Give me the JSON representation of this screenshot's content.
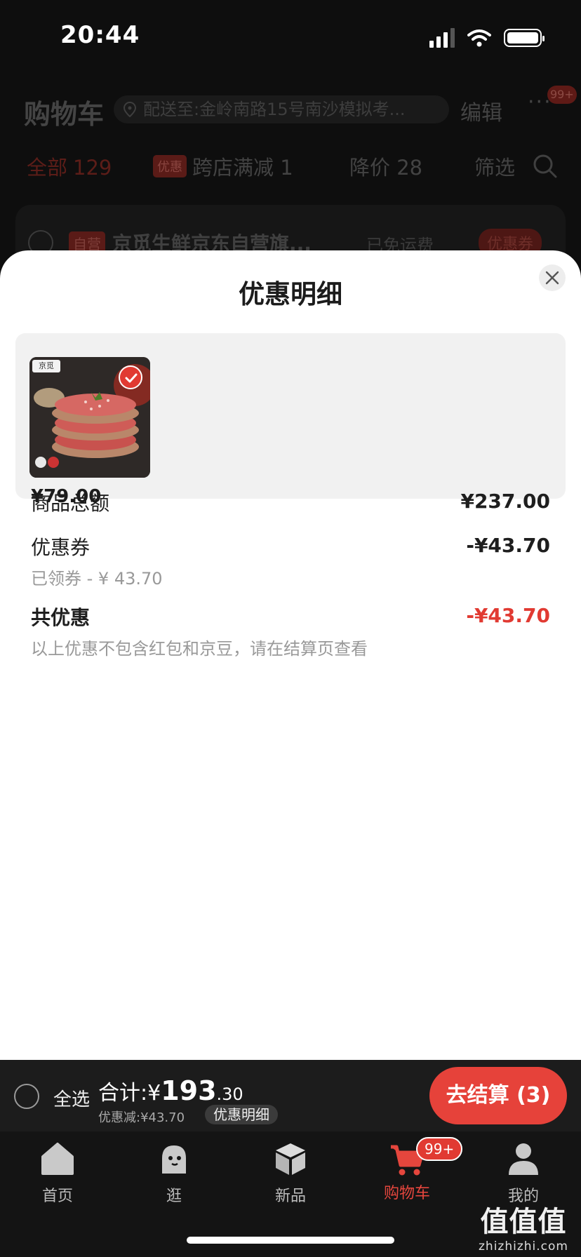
{
  "status_bar": {
    "time": "20:44"
  },
  "cart": {
    "title": "购物车",
    "address": "配送至:金岭南路15号南沙模拟考...",
    "edit_label": "编辑",
    "more_badge": "99+",
    "filters": {
      "all_label": "全部",
      "all_count": "129",
      "promo_tag": "优惠",
      "cross_store_label": "跨店满减 1",
      "price_drop_label": "降价 28",
      "filter_label": "筛选"
    },
    "store": {
      "self_tag": "自营",
      "name": "京觅生鲜京东自营旗...",
      "shipping": "已免运费",
      "coupon": "优惠券"
    }
  },
  "sheet": {
    "title": "优惠明细",
    "product": {
      "price": "¥79.00",
      "brand": "京觅"
    },
    "lines": {
      "goods_total_label": "商品总额",
      "goods_total_value": "¥237.00",
      "coupon_label": "优惠券",
      "coupon_value": "-¥43.70",
      "coupon_sub": "已领券 - ¥ 43.70",
      "total_discount_label": "共优惠",
      "total_discount_value": "-¥43.70",
      "note": "以上优惠不包含红包和京豆，请在结算页查看"
    }
  },
  "checkout_bar": {
    "select_all_label": "全选",
    "sum_prefix": "合计:¥",
    "sum_int": "193",
    "sum_dec": ".30",
    "discount_text": "优惠减:¥43.70",
    "detail_label": "优惠明细",
    "checkout_label": "去结算 (3)"
  },
  "tab_bar": {
    "tabs": [
      {
        "label": "首页",
        "icon": "home-icon"
      },
      {
        "label": "逛",
        "icon": "explore-icon"
      },
      {
        "label": "新品",
        "icon": "box-icon"
      },
      {
        "label": "购物车",
        "icon": "cart-icon",
        "badge": "99+"
      },
      {
        "label": "我的",
        "icon": "user-icon"
      }
    ],
    "active_color": "#e5463d"
  },
  "watermark": {
    "brand": "值值值",
    "domain": "zhizhizhi.com"
  },
  "colors": {
    "accent": "#e13a32",
    "checkout_button": "#e6423a"
  }
}
